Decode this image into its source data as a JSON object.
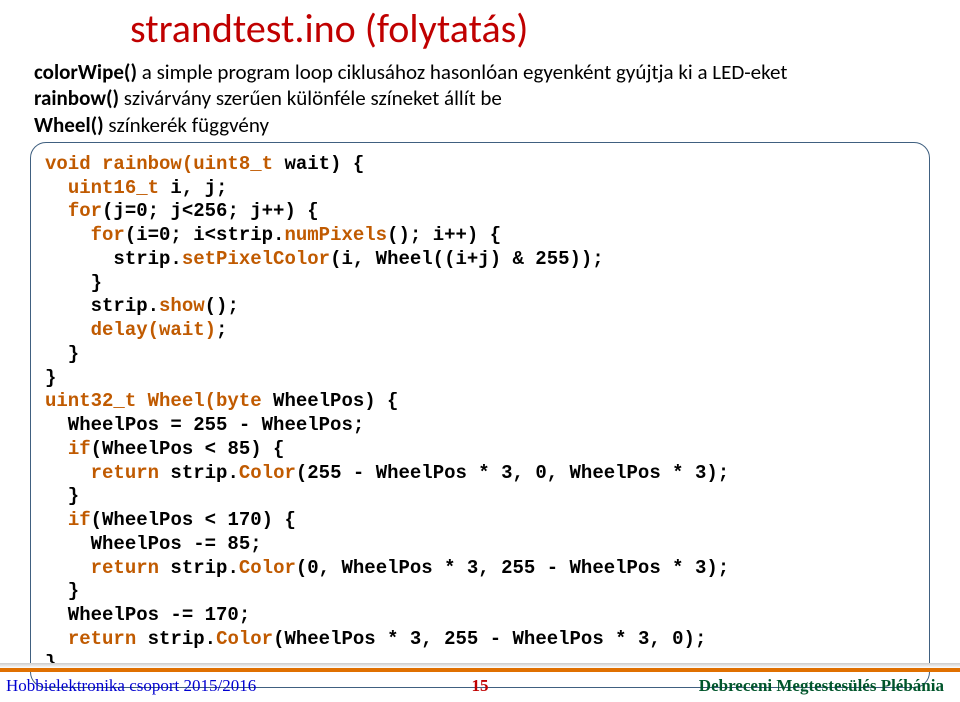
{
  "title": "strandtest.ino (folytatás)",
  "desc": {
    "fn1": "colorWipe()",
    "d1": " a simple program loop ciklusához hasonlóan egyenként gyújtja ki a LED-eket",
    "fn2": "rainbow()",
    "d2": " szivárvány szerűen különféle színeket állít be",
    "fn3": "Wheel()",
    "d3": " színkerék függvény"
  },
  "code": {
    "kw_void": "void",
    "fn_rainbow": "rainbow(uint8_t",
    "t1": " wait) {",
    "typ_u16": "uint16_t",
    "t2": " i, j;",
    "kw_for1": "for",
    "t3": "(j=0; j<256; j++) {",
    "kw_for2": "for",
    "t4": "(i=0; i<strip.",
    "numPixels": "numPixels",
    "t4b": "(); i++) {",
    "t5a": "      strip.",
    "setPixelColor": "setPixelColor",
    "t5b": "(i, Wheel((i+j) & 255));",
    "t6": "    }",
    "t7a": "    strip.",
    "show": "show",
    "t7b": "();",
    "kw_delay": "delay(wait)",
    "t8": ";",
    "t9": "  }",
    "t10": "}",
    "typ_u32": "uint32_t",
    "fn_wheel": " Wheel(byte",
    "t11": " WheelPos) {",
    "t12": "  WheelPos = 255 - WheelPos;",
    "kw_if1": "if",
    "t13": "(WheelPos < 85) {",
    "kw_ret1": "return",
    "t14a": " strip.",
    "color1": "Color",
    "t14b": "(255 - WheelPos * 3, 0, WheelPos * 3);",
    "t15": "  }",
    "kw_if2": "if",
    "t16": "(WheelPos < 170) {",
    "t17": "    WheelPos -= 85;",
    "kw_ret2": "return",
    "t18a": " strip.",
    "color2": "Color",
    "t18b": "(0, WheelPos * 3, 255 - WheelPos * 3);",
    "t19": "  }",
    "t20": "  WheelPos -= 170;",
    "kw_ret3": "return",
    "t21a": " strip.",
    "color3": "Color",
    "t21b": "(WheelPos * 3, 255 - WheelPos * 3, 0);",
    "t22": "}"
  },
  "footer": {
    "left": "Hobbielektronika csoport 2015/2016",
    "center": "15",
    "right": "Debreceni Megtestesülés Plébánia"
  }
}
